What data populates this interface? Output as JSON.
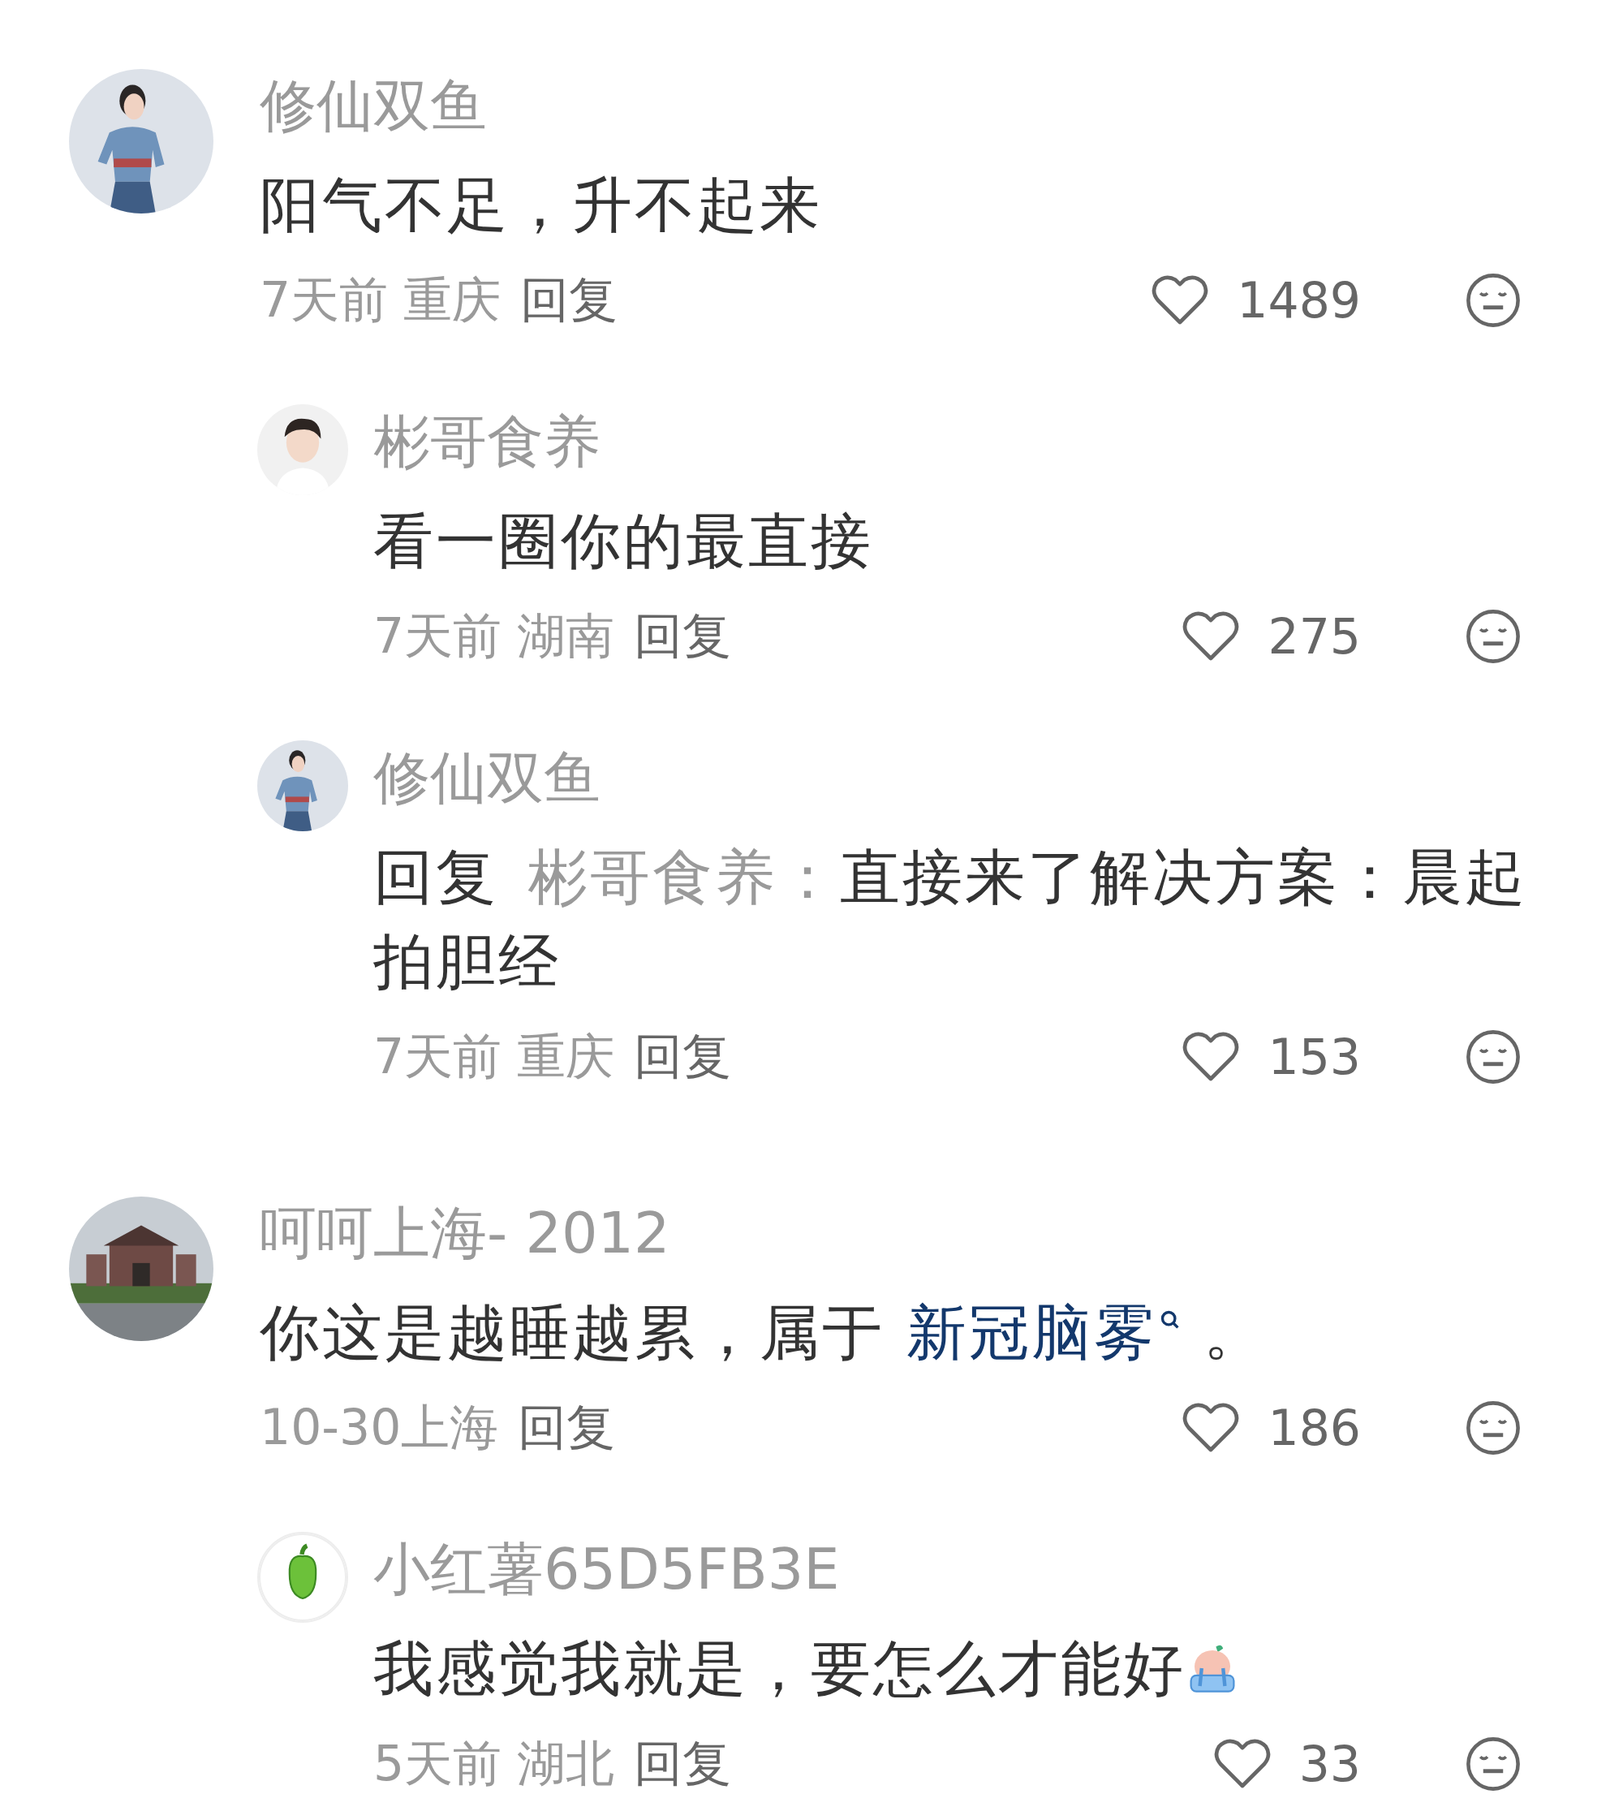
{
  "comments": [
    {
      "avatar": {
        "kind": "picture"
      },
      "author": "修仙双鱼",
      "segments": [
        {
          "kind": "text",
          "text": "阳气不足，升不起来"
        }
      ],
      "meta": "7天前 重庆",
      "reply_label": "回复",
      "likes": "1489",
      "replies": [
        {
          "avatar": {
            "kind": "picture"
          },
          "author": "彬哥食养",
          "segments": [
            {
              "kind": "text",
              "text": "看一圈你的最直接"
            }
          ],
          "meta": "7天前 湖南",
          "reply_label": "回复",
          "likes": "275"
        },
        {
          "avatar": {
            "kind": "picture"
          },
          "author": "修仙双鱼",
          "segments": [
            {
              "kind": "reply",
              "text": "回复"
            },
            {
              "kind": "mention",
              "text": "彬哥食养："
            },
            {
              "kind": "text",
              "text": "直接来了解决方案：晨起拍胆经"
            }
          ],
          "meta": "7天前 重庆",
          "reply_label": "回复",
          "likes": "153"
        }
      ]
    },
    {
      "avatar": {
        "kind": "picture"
      },
      "author": "呵呵上海- 2012",
      "segments": [
        {
          "kind": "text",
          "text": "你这是越睡越累，属于 "
        },
        {
          "kind": "link",
          "text": "新冠脑雾"
        },
        {
          "kind": "text",
          "text": " 。"
        }
      ],
      "meta": "10-30上海",
      "reply_label": "回复",
      "likes": "186",
      "replies": [
        {
          "avatar": {
            "kind": "pepper"
          },
          "author": "小红薯65D5FB3E",
          "segments": [
            {
              "kind": "text",
              "text": "我感觉我就是，要怎么才能好"
            },
            {
              "kind": "sticker"
            }
          ],
          "meta": "5天前 湖北",
          "reply_label": "回复",
          "likes": "33"
        }
      ]
    }
  ]
}
